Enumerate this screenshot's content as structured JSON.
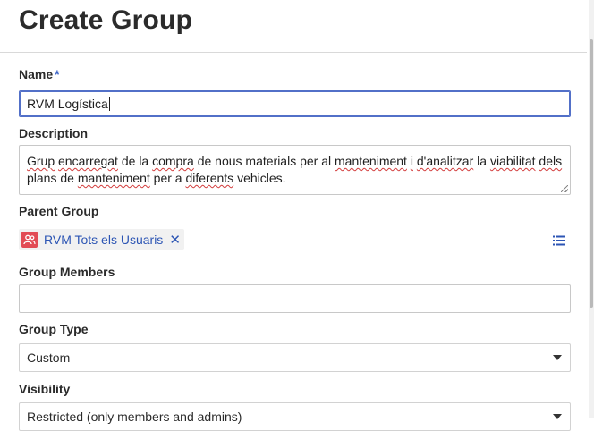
{
  "header": {
    "title": "Create Group"
  },
  "form": {
    "name": {
      "label": "Name",
      "required_marker": "*",
      "value": "RVM Logística"
    },
    "description": {
      "label": "Description",
      "value": "Grup encarregat de la compra de nous materials per al manteniment i d'analitzar la viabilitat dels plans de manteniment per a diferents vehicles.",
      "misspelled_words": [
        "Grup",
        "encarregat",
        "compra",
        "manteniment",
        "i",
        "d'analitzar",
        "viabilitat",
        "dels",
        "manteniment",
        "diferents"
      ]
    },
    "parent_group": {
      "label": "Parent Group",
      "selected": "RVM Tots els Usuaris",
      "remove_glyph": "✕",
      "chip_icon": "group-icon",
      "browse_icon": "list-icon"
    },
    "group_members": {
      "label": "Group Members",
      "value": ""
    },
    "group_type": {
      "label": "Group Type",
      "selected": "Custom"
    },
    "visibility": {
      "label": "Visibility",
      "selected": "Restricted (only members and admins)"
    }
  },
  "colors": {
    "accent": "#3a63c8",
    "focus_border": "#5270c8",
    "chip_icon_bg": "#e24b55",
    "chip_text": "#2c55b4",
    "spellcheck": "#d23b3b"
  }
}
